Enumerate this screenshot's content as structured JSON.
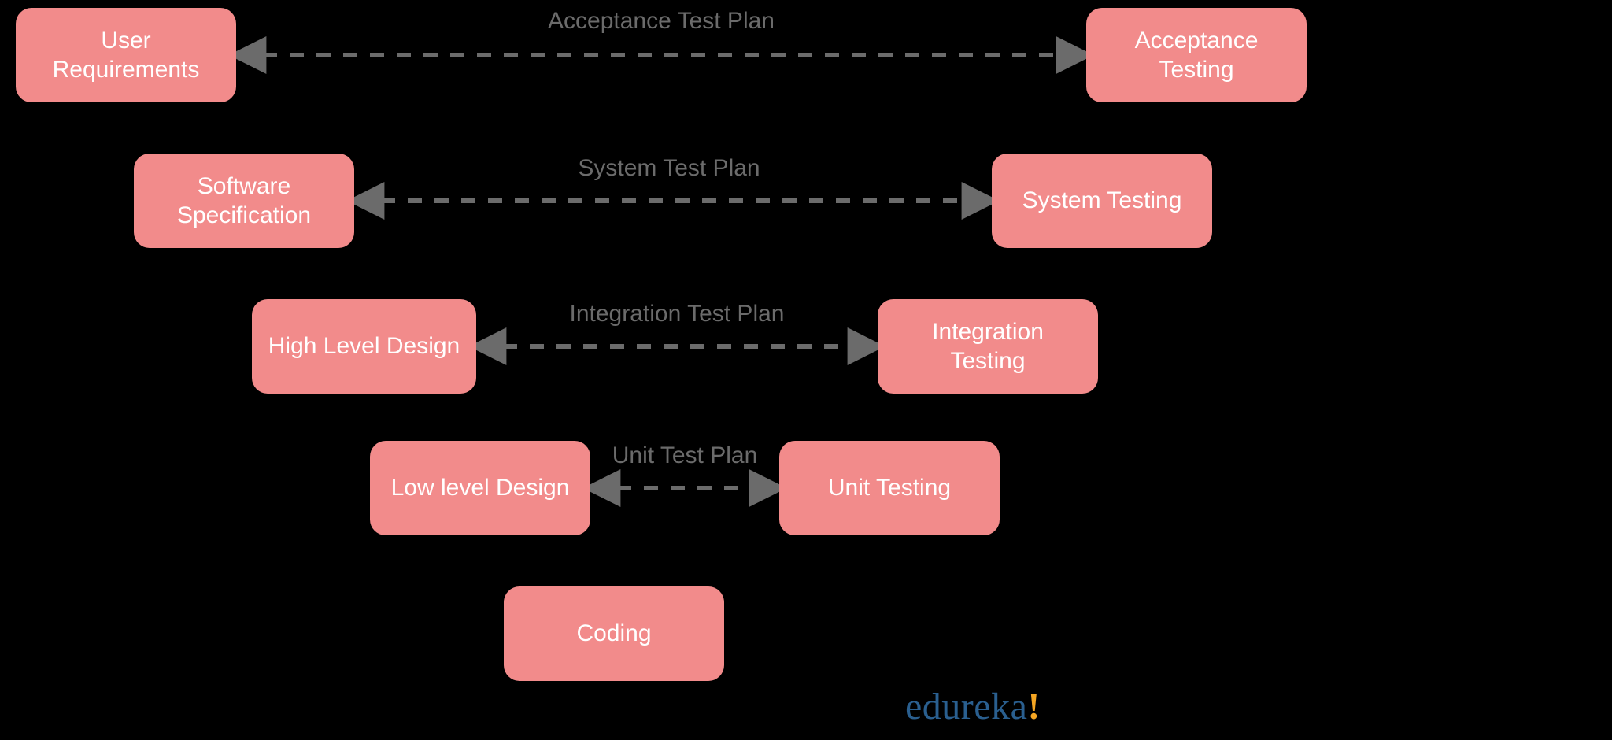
{
  "nodes": {
    "user_requirements": "User\nRequirements",
    "software_specification": "Software\nSpecification",
    "high_level_design": "High Level Design",
    "low_level_design": "Low level Design",
    "coding": "Coding",
    "unit_testing": "Unit Testing",
    "integration_testing": "Integration\nTesting",
    "system_testing": "System Testing",
    "acceptance_testing": "Acceptance\nTesting"
  },
  "edges": {
    "acceptance_plan": "Acceptance Test Plan",
    "system_plan": "System Test Plan",
    "integration_plan": "Integration Test Plan",
    "unit_plan": "Unit Test Plan"
  },
  "brand": {
    "name": "edureka",
    "bang": "!"
  },
  "colors": {
    "node_bg": "#f28b8b",
    "node_fg": "#ffffff",
    "edge_label": "#6b6b6b",
    "dash": "#6b6b6b",
    "brand": "#2a5f8f",
    "brand_bang": "#f5a623"
  }
}
